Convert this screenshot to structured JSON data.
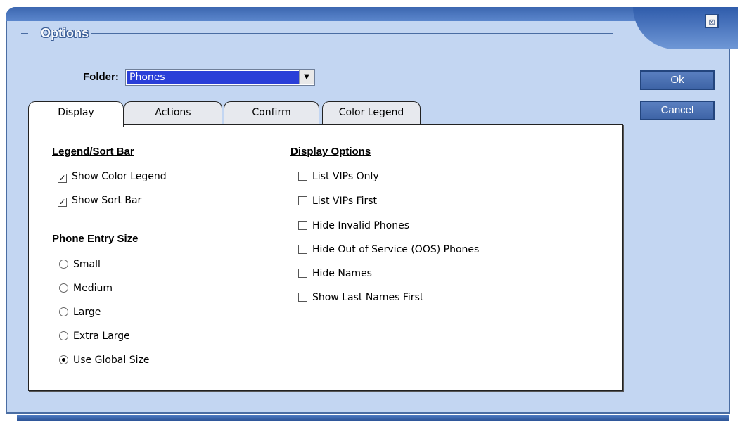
{
  "window": {
    "title": "Options",
    "close_glyph": "☒"
  },
  "folder": {
    "label": "Folder:",
    "value": "Phones",
    "arrow": "▼"
  },
  "buttons": {
    "ok": "Ok",
    "cancel": "Cancel"
  },
  "tabs": [
    {
      "label": "Display",
      "active": true
    },
    {
      "label": "Actions",
      "active": false
    },
    {
      "label": "Confirm",
      "active": false
    },
    {
      "label": "Color Legend",
      "active": false
    }
  ],
  "legend_sort": {
    "title": "Legend/Sort Bar",
    "items": [
      {
        "label": "Show Color Legend",
        "checked": true
      },
      {
        "label": "Show Sort Bar",
        "checked": true
      }
    ]
  },
  "phone_entry_size": {
    "title": "Phone Entry Size",
    "options": [
      {
        "label": "Small",
        "selected": false
      },
      {
        "label": "Medium",
        "selected": false
      },
      {
        "label": "Large",
        "selected": false
      },
      {
        "label": "Extra Large",
        "selected": false
      },
      {
        "label": "Use Global Size",
        "selected": true
      }
    ]
  },
  "display_options": {
    "title": "Display Options",
    "items": [
      {
        "label": "List VIPs Only",
        "checked": false
      },
      {
        "label": "List VIPs First",
        "checked": false
      },
      {
        "label": "Hide Invalid Phones",
        "checked": false
      },
      {
        "label": "Hide Out of Service (OOS) Phones",
        "checked": false
      },
      {
        "label": "Hide Names",
        "checked": false
      },
      {
        "label": "Show Last Names First",
        "checked": false
      }
    ]
  },
  "colors": {
    "window_bg": "#c3d6f2",
    "border": "#4a6da3",
    "selection": "#2a3fd8",
    "button": "#4e74b6"
  },
  "icons": {
    "close": "close-icon",
    "dropdown": "chevron-down-icon",
    "check": "checkmark-icon"
  }
}
